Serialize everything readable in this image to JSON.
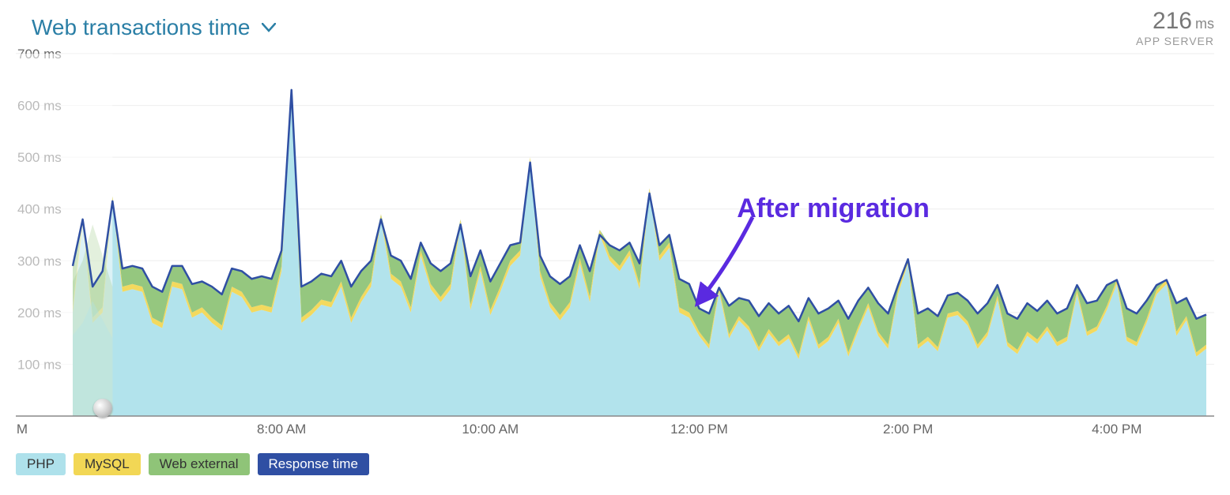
{
  "header": {
    "title": "Web transactions time",
    "metric_value": "216",
    "metric_unit": "ms",
    "metric_sub": "APP SERVER"
  },
  "annotation": {
    "text": "After migration"
  },
  "legend": [
    {
      "key": "php",
      "label": "PHP",
      "class": "lg-php",
      "color": "#aee1eb"
    },
    {
      "key": "mysql",
      "label": "MySQL",
      "class": "lg-mysql",
      "color": "#f2d755"
    },
    {
      "key": "ext",
      "label": "Web external",
      "class": "lg-ext",
      "color": "#8fc478"
    },
    {
      "key": "resp",
      "label": "Response time",
      "class": "lg-resp",
      "color": "#2f4fa3"
    }
  ],
  "chart_data": {
    "type": "area",
    "title": "Web transactions time",
    "ylabel": "ms",
    "xlabel": "",
    "ylim": [
      0,
      700
    ],
    "y_ticks": [
      100,
      200,
      300,
      400,
      500,
      600,
      700
    ],
    "y_tick_labels": [
      "100 ms",
      "200 ms",
      "300 ms",
      "400 ms",
      "500 ms",
      "600 ms",
      "700 ms"
    ],
    "x_tick_positions": [
      21,
      42,
      63,
      84,
      105
    ],
    "x_tick_labels": [
      "8:00 AM",
      "10:00 AM",
      "12:00 PM",
      "2:00 PM",
      "4:00 PM"
    ],
    "x_left_label": "M",
    "legend_position": "bottom",
    "annotation": {
      "text": "After migration",
      "x_index": 66,
      "color": "#5a2ae0"
    },
    "series": [
      {
        "name": "PHP",
        "color": "#aee1eb",
        "stack": true,
        "values": [
          200,
          370,
          180,
          200,
          415,
          240,
          245,
          240,
          180,
          170,
          250,
          245,
          190,
          200,
          180,
          165,
          240,
          230,
          200,
          205,
          200,
          280,
          620,
          180,
          195,
          215,
          210,
          250,
          180,
          220,
          250,
          380,
          265,
          250,
          200,
          310,
          245,
          220,
          245,
          370,
          205,
          280,
          195,
          240,
          290,
          310,
          490,
          270,
          210,
          185,
          210,
          295,
          220,
          350,
          300,
          280,
          310,
          245,
          430,
          300,
          325,
          200,
          190,
          155,
          130,
          240,
          150,
          185,
          165,
          125,
          160,
          135,
          150,
          110,
          185,
          130,
          145,
          180,
          115,
          165,
          210,
          155,
          130,
          235,
          295,
          130,
          145,
          125,
          190,
          195,
          175,
          130,
          155,
          225,
          135,
          120,
          155,
          140,
          165,
          135,
          145,
          235,
          155,
          165,
          205,
          255,
          145,
          135,
          180,
          235,
          255,
          155,
          185,
          115,
          130
        ]
      },
      {
        "name": "MySQL",
        "color": "#f2d755",
        "stack": true,
        "values": [
          10,
          10,
          10,
          10,
          10,
          10,
          10,
          10,
          10,
          10,
          10,
          10,
          10,
          10,
          10,
          10,
          10,
          10,
          10,
          10,
          10,
          10,
          10,
          10,
          10,
          10,
          10,
          10,
          10,
          10,
          10,
          10,
          10,
          10,
          10,
          10,
          10,
          10,
          10,
          10,
          10,
          10,
          10,
          10,
          10,
          10,
          10,
          10,
          10,
          10,
          10,
          10,
          10,
          10,
          10,
          10,
          10,
          10,
          10,
          10,
          10,
          10,
          10,
          8,
          8,
          8,
          8,
          8,
          8,
          8,
          8,
          8,
          8,
          8,
          8,
          8,
          8,
          8,
          8,
          8,
          8,
          8,
          8,
          8,
          8,
          8,
          8,
          8,
          8,
          8,
          8,
          8,
          8,
          8,
          8,
          8,
          8,
          8,
          8,
          8,
          8,
          8,
          8,
          8,
          8,
          8,
          8,
          8,
          8,
          8,
          8,
          8,
          8,
          8,
          8
        ]
      },
      {
        "name": "Web external",
        "color": "#8fc478",
        "stack": true,
        "values": [
          80,
          0,
          60,
          70,
          0,
          35,
          35,
          35,
          60,
          60,
          30,
          35,
          55,
          50,
          60,
          60,
          35,
          40,
          55,
          55,
          55,
          30,
          0,
          60,
          55,
          50,
          50,
          40,
          60,
          50,
          40,
          0,
          35,
          40,
          55,
          15,
          40,
          50,
          40,
          0,
          55,
          30,
          55,
          45,
          30,
          15,
          0,
          30,
          50,
          60,
          50,
          25,
          50,
          0,
          20,
          30,
          15,
          40,
          0,
          20,
          15,
          55,
          55,
          45,
          60,
          0,
          55,
          35,
          50,
          60,
          50,
          55,
          55,
          65,
          35,
          60,
          55,
          35,
          65,
          50,
          30,
          55,
          60,
          10,
          0,
          60,
          55,
          60,
          35,
          35,
          40,
          60,
          55,
          20,
          55,
          60,
          55,
          55,
          50,
          55,
          55,
          10,
          55,
          50,
          40,
          0,
          55,
          55,
          35,
          10,
          0,
          55,
          35,
          65,
          58
        ]
      },
      {
        "name": "Response time",
        "color": "#2f4fa3",
        "stack": false,
        "line_only": true,
        "values": [
          290,
          380,
          250,
          280,
          415,
          285,
          290,
          285,
          250,
          240,
          290,
          290,
          255,
          260,
          250,
          235,
          285,
          280,
          265,
          270,
          265,
          320,
          630,
          250,
          260,
          275,
          270,
          300,
          250,
          280,
          300,
          380,
          310,
          300,
          265,
          335,
          295,
          280,
          295,
          370,
          270,
          320,
          260,
          295,
          330,
          335,
          490,
          310,
          270,
          255,
          270,
          330,
          280,
          350,
          330,
          320,
          335,
          295,
          430,
          330,
          350,
          265,
          255,
          208,
          198,
          248,
          213,
          228,
          223,
          193,
          218,
          198,
          213,
          183,
          228,
          198,
          208,
          223,
          188,
          223,
          248,
          218,
          198,
          253,
          303,
          198,
          208,
          193,
          233,
          238,
          223,
          198,
          218,
          253,
          198,
          188,
          218,
          203,
          223,
          198,
          208,
          253,
          218,
          223,
          253,
          263,
          208,
          198,
          223,
          253,
          263,
          218,
          228,
          188,
          196
        ]
      }
    ]
  }
}
